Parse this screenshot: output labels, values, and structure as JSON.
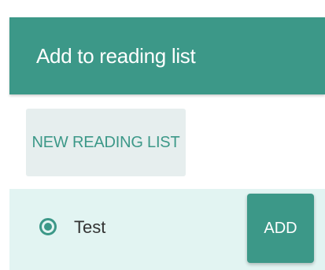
{
  "colors": {
    "accent": "#3c9888",
    "button_bg": "#e6eeee",
    "row_bg": "#e2f4f2"
  },
  "header": {
    "title": "Add to reading list"
  },
  "new_list_button": {
    "label": "NEW READING LIST"
  },
  "reading_lists": [
    {
      "name": "Test",
      "selected": true,
      "action_label": "ADD"
    }
  ]
}
